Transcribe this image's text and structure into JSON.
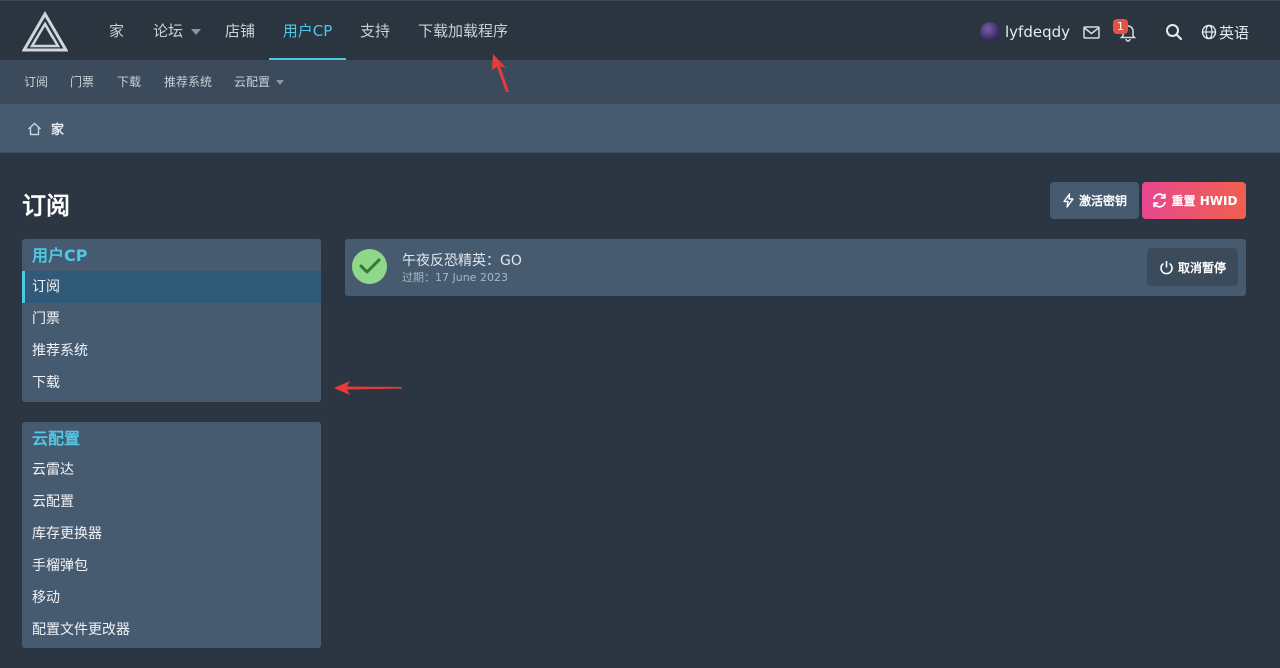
{
  "top_nav": {
    "items": [
      "家",
      "论坛",
      "店铺",
      "用户CP",
      "支持",
      "下载加载程序"
    ],
    "active": "用户CP"
  },
  "user": {
    "name": "lyfdeqdy",
    "notification_count": "1"
  },
  "language": {
    "label": "英语"
  },
  "sub_nav": {
    "items": [
      "订阅",
      "门票",
      "下载",
      "推荐系统",
      "云配置"
    ]
  },
  "breadcrumb": {
    "home": "家"
  },
  "page": {
    "title": "订阅",
    "activate_key_label": "激活密钥",
    "reset_hwid_label": "重置 HWID"
  },
  "sidebar": {
    "usercp": {
      "title": "用户CP",
      "items": [
        "订阅",
        "门票",
        "推荐系统",
        "下载"
      ],
      "active": "订阅"
    },
    "cloud": {
      "title": "云配置",
      "items": [
        "云雷达",
        "云配置",
        "库存更换器",
        "手榴弹包",
        "移动",
        "配置文件更改器"
      ]
    }
  },
  "subscription": {
    "name": "午夜反恐精英：GO",
    "expiry": "过期：17 June 2023",
    "action_label": "取消暂停"
  },
  "colors": {
    "accent": "#4fc8e8",
    "reset_gradient_start": "#e8478f",
    "reset_gradient_end": "#f0604d",
    "status_ok": "#8fd88a",
    "annotation_arrow": "#e83a3a"
  },
  "icons": [
    "logo-icon",
    "caret-down-icon",
    "mail-icon",
    "bell-icon",
    "search-icon",
    "globe-icon",
    "home-icon",
    "bolt-icon",
    "refresh-icon",
    "check-icon",
    "power-icon"
  ]
}
